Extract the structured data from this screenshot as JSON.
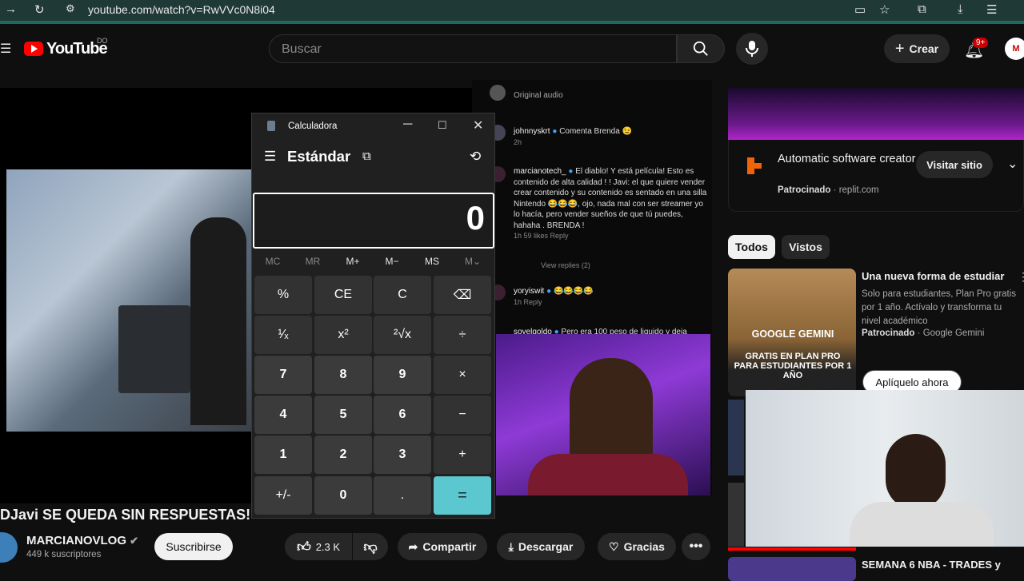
{
  "browser": {
    "url": "youtube.com/watch?v=RwVVc0N8i04"
  },
  "header": {
    "logo_text": "YouTube",
    "logo_sup": "DO",
    "search_placeholder": "Buscar",
    "create_label": "Crear",
    "notif_badge": "9+",
    "avatar_text": "M"
  },
  "video": {
    "title": "DJavi SE QUEDA SIN RESPUESTAS!",
    "channel": "MARCIANOVLOG",
    "subscribers": "449 k suscriptores",
    "subscribe_label": "Suscribirse",
    "likes": "2.3 K",
    "share_label": "Compartir",
    "download_label": "Descargar",
    "thanks_label": "Gracias"
  },
  "comments": [
    {
      "text": "Original audio"
    },
    {
      "user": "johnnyskrt",
      "text": "Comenta Brenda 😉",
      "meta": "2h"
    },
    {
      "user": "marcianotech_",
      "text": "El diablo! Y está película! Esto es contenido de alta calidad ! ! Javi: el que quiere vender crear contenido y su contenido es sentado en una silla Nintendo 😂😂😂, ojo, nada mal con ser streamer yo lo hacía, pero vender sueños de que tú puedes, hahaha . BRENDA !",
      "meta": "1h  59 likes  Reply"
    },
    {
      "text": "View replies (2)"
    },
    {
      "user": "yoryiswit",
      "text": "😂😂😂😂",
      "meta": "1h  Reply"
    },
    {
      "user": "soyelgoldo",
      "text": "Pero era 100 peso de liquido y deja"
    }
  ],
  "calculator": {
    "title": "Calculadora",
    "mode": "Estándar",
    "display": "0",
    "memory": [
      "MC",
      "MR",
      "M+",
      "M−",
      "MS",
      "M⌄"
    ],
    "keys": [
      [
        "%",
        "CE",
        "C",
        "⌫"
      ],
      [
        "¹⁄ₓ",
        "x²",
        "²√x",
        "÷"
      ],
      [
        "7",
        "8",
        "9",
        "×"
      ],
      [
        "4",
        "5",
        "6",
        "−"
      ],
      [
        "1",
        "2",
        "3",
        "+"
      ],
      [
        "+/-",
        "0",
        ".",
        "="
      ]
    ]
  },
  "sidebar": {
    "ad1": {
      "title": "Automatic software creator",
      "sponsored": "Patrocinado",
      "domain": "replit.com",
      "button": "Visitar sitio"
    },
    "chips": [
      "Todos",
      "Vistos"
    ],
    "ad2": {
      "title": "Una nueva forma de estudiar",
      "desc": "Solo para estudiantes, Plan Pro gratis por 1 año. Actívalo y transforma tu nivel académico",
      "sponsored": "Patrocinado",
      "advertiser": "Google Gemini",
      "button": "Aplíquelo ahora",
      "thumb_title": "GOOGLE GEMINI",
      "thumb_sub": "GRATIS EN PLAN PRO PARA ESTUDIANTES POR 1 AÑO"
    },
    "next_title": "SEMANA 6 NBA - TRADES y"
  }
}
